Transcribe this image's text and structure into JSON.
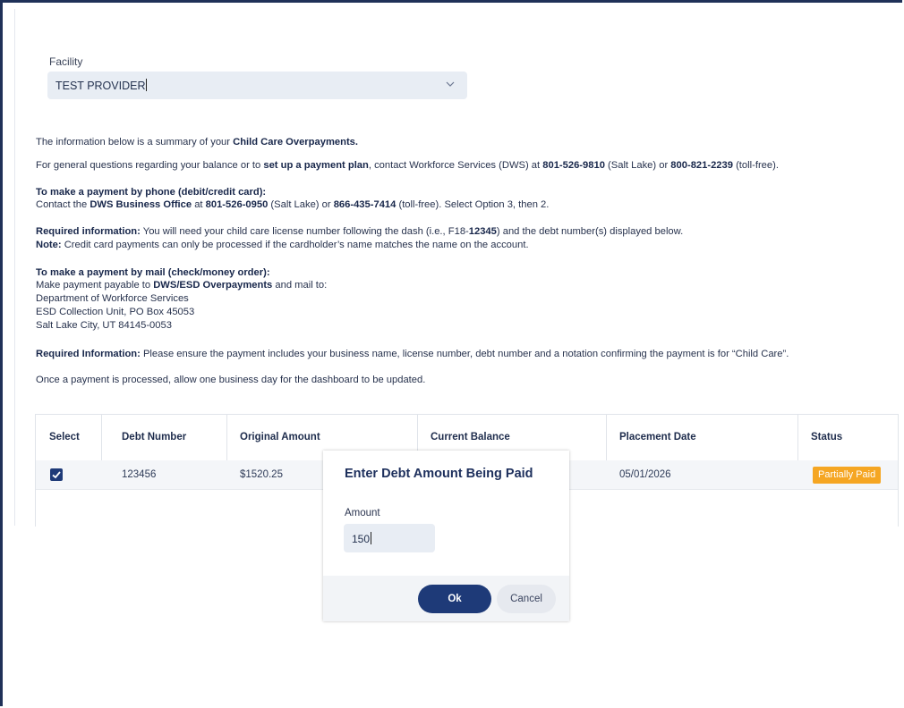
{
  "facility": {
    "label": "Facility",
    "selected": "TEST PROVIDER"
  },
  "info": {
    "summary_pre": "The information below is a summary of your ",
    "summary_bold": "Child Care Overpayments.",
    "general_pre": "For general questions regarding your balance or to ",
    "general_bold": "set up a payment plan",
    "general_mid": ", contact Workforce Services (DWS) at ",
    "general_phone1": "801-526-9810",
    "general_mid2": " (Salt Lake) or ",
    "general_phone2": "800-821-2239",
    "general_post": " (toll-free).",
    "phone_heading": "To make a payment by phone (debit/credit card):",
    "phone_pre": "Contact the ",
    "phone_bold": "DWS Business Office",
    "phone_mid": " at ",
    "phone_num1": "801-526-0950",
    "phone_mid2": " (Salt Lake) or ",
    "phone_num2": "866-435-7414",
    "phone_post": " (toll-free). Select Option 3, then 2.",
    "req_bold": "Required information:",
    "req_pre": " You will need your child care license number following the dash (i.e., F18-",
    "req_example": "12345",
    "req_post": ") and the debt number(s) displayed below.",
    "note_bold": "Note:",
    "note_text": " Credit card payments can only be processed if the cardholder’s name matches the name on the account.",
    "mail_heading": "To make a payment by mail (check/money order):",
    "mail_pre": "Make payment payable to ",
    "mail_bold": "DWS/ESD Overpayments",
    "mail_post": " and mail to:",
    "mail_line1": "Department of Workforce Services",
    "mail_line2": "ESD Collection Unit, PO Box 45053",
    "mail_line3": "Salt Lake City, UT 84145-0053",
    "req2_bold": "Required Information:",
    "req2_text": " Please ensure the payment includes your business name, license number, debt number and a notation confirming the payment is for “Child Care”.",
    "processed": "Once a payment is processed, allow one business day for the dashboard to be updated."
  },
  "table": {
    "headers": [
      "Select",
      "Debt Number",
      "Original Amount",
      "Current Balance",
      "Placement Date",
      "Status"
    ],
    "rows": [
      {
        "debt_number": "123456",
        "original_amount": "$1520.25",
        "placement_date": "05/01/2026",
        "status": "Partially Paid",
        "selected": true
      }
    ]
  },
  "modal": {
    "title": "Enter Debt Amount Being Paid",
    "amount_label": "Amount",
    "amount_value": "150",
    "ok_label": "Ok",
    "cancel_label": "Cancel"
  },
  "colors": {
    "primary": "#1e3a78",
    "status_partial": "#f5a623",
    "input_bg": "#e8edf4"
  }
}
